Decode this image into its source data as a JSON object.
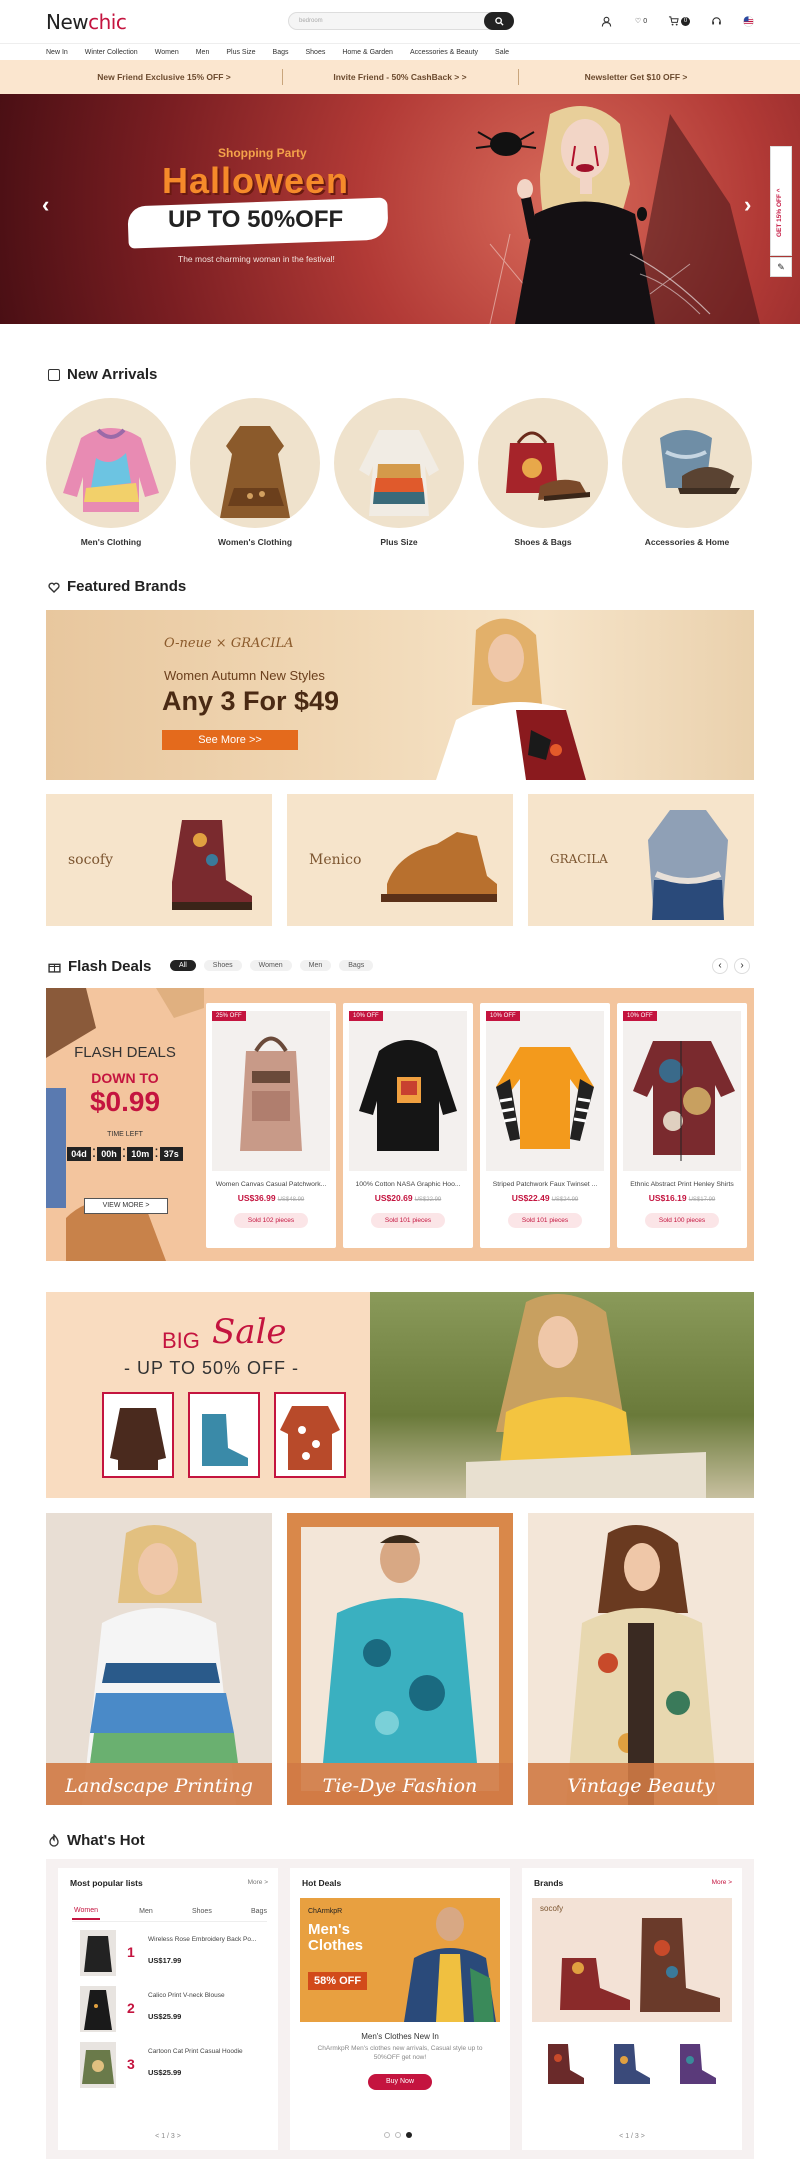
{
  "header": {
    "logo_a": "New",
    "logo_b": "chic",
    "search_placeholder": "bedroom",
    "wishlist_count": "0",
    "cart_count": "0"
  },
  "nav": [
    "New In",
    "Winter Collection",
    "Women",
    "Men",
    "Plus Size",
    "Bags",
    "Shoes",
    "Home & Garden",
    "Accessories & Beauty",
    "Sale"
  ],
  "promo": [
    "New Friend Exclusive 15% OFF >",
    "Invite Friend - 50% CashBack > >",
    "Newsletter Get $10 OFF >"
  ],
  "hero": {
    "kicker": "Shopping Party",
    "title": "Halloween",
    "offer": "UP TO 50%OFF",
    "tagline": "The most charming woman in the festival!",
    "side_tab": "GET 15% OFF ^"
  },
  "new_arrivals": {
    "title": "New Arrivals",
    "items": [
      "Men's Clothing",
      "Women's Clothing",
      "Plus Size",
      "Shoes & Bags",
      "Accessories & Home"
    ]
  },
  "featured": {
    "title": "Featured Brands",
    "brand_line": "O-neue × GRACILA",
    "subtitle": "Women Autumn New Styles",
    "headline": "Any 3 For $49",
    "cta": "See More >>",
    "cards": [
      "socofy",
      "Menico",
      "GRACILA"
    ]
  },
  "flash": {
    "title": "Flash Deals",
    "chips": [
      "All",
      "Shoes",
      "Women",
      "Men",
      "Bags"
    ],
    "panel_title": "FLASH DEALS",
    "panel_down": "DOWN TO",
    "panel_price": "$0.99",
    "time_left": "TIME LEFT",
    "countdown": [
      "04d",
      "00h",
      "10m",
      "37s"
    ],
    "view_more": "VIEW MORE >",
    "products": [
      {
        "tag": "25% OFF",
        "name": "Women Canvas Casual Patchwork...",
        "price": "US$36.99",
        "old": "US$48.99",
        "sold": "Sold 102 pieces"
      },
      {
        "tag": "10% OFF",
        "name": "100% Cotton NASA Graphic Hoo...",
        "price": "US$20.69",
        "old": "US$22.99",
        "sold": "Sold 101 pieces"
      },
      {
        "tag": "10% OFF",
        "name": "Striped Patchwork Faux Twinset ...",
        "price": "US$22.49",
        "old": "US$24.99",
        "sold": "Sold 101 pieces"
      },
      {
        "tag": "10% OFF",
        "name": "Ethnic Abstract Print Henley Shirts",
        "price": "US$16.19",
        "old": "US$17.99",
        "sold": "Sold 100 pieces"
      }
    ]
  },
  "bigsale": {
    "big": "BIG",
    "sale": "Sale",
    "offer": "- UP TO 50% OFF -"
  },
  "promos": [
    "Landscape Printing",
    "Tie-Dye Fashion",
    "Vintage Beauty"
  ],
  "hot": {
    "title": "What's Hot",
    "popular": {
      "title": "Most popular lists",
      "more": "More >",
      "tabs": [
        "Women",
        "Men",
        "Shoes",
        "Bags"
      ],
      "items": [
        {
          "no": "1",
          "name": "Wireless Rose Embroidery Back Po...",
          "price": "US$17.99"
        },
        {
          "no": "2",
          "name": "Calico Print V-neck Blouse",
          "price": "US$25.99"
        },
        {
          "no": "3",
          "name": "Cartoon Cat Print Casual Hoodie",
          "price": "US$25.99"
        }
      ],
      "pager": "< 1 / 3 >"
    },
    "deals": {
      "title": "Hot Deals",
      "brand": "ChArmkpR",
      "ad_title": "Men's Clothes",
      "ad_off": "58% OFF",
      "name": "Men's Clothes New In",
      "desc": "ChArmkpR Men's clothes new arrivals, Casual style up to 50%OFF get now!",
      "cta": "Buy Now"
    },
    "brands": {
      "title": "Brands",
      "more": "More >",
      "brand": "socofy",
      "pager": "< 1 / 3 >"
    }
  },
  "colors": {
    "accent": "#c4143f",
    "promo_bg": "#fbe6cf"
  }
}
